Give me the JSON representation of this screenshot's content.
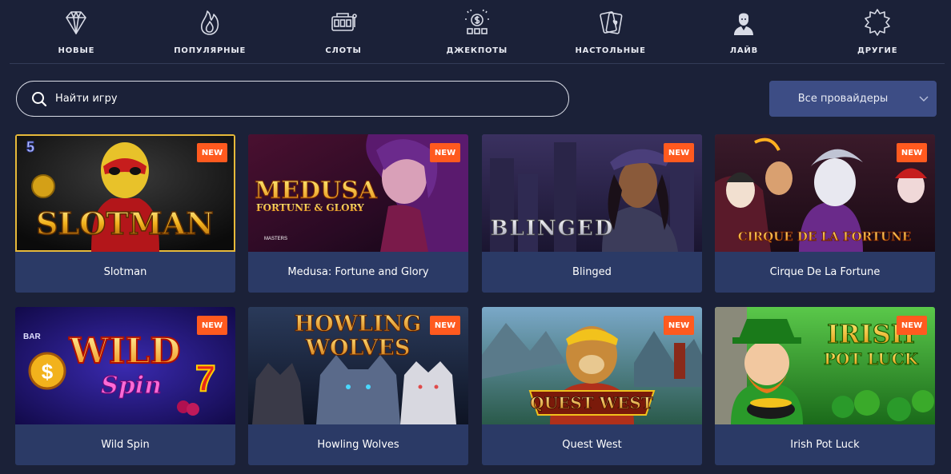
{
  "nav": {
    "items": [
      {
        "label": "НОВЫЕ",
        "icon": "diamond-icon"
      },
      {
        "label": "ПОПУЛЯРНЫЕ",
        "icon": "flame-icon"
      },
      {
        "label": "СЛОТЫ",
        "icon": "slot-machine-icon"
      },
      {
        "label": "ДЖЕКПОТЫ",
        "icon": "jackpot-icon"
      },
      {
        "label": "НАСТОЛЬНЫЕ",
        "icon": "playing-cards-icon"
      },
      {
        "label": "ЛАЙВ",
        "icon": "live-dealer-icon"
      },
      {
        "label": "ДРУГИЕ",
        "icon": "star-burst-icon"
      }
    ]
  },
  "search": {
    "placeholder": "Найти игру",
    "icon": "search-icon"
  },
  "provider": {
    "selected": "Все провайдеры",
    "icon": "chevron-down-icon"
  },
  "games": [
    {
      "title": "Slotman",
      "badge": "NEW",
      "logo": "SLOTMAN",
      "logo_sub": "",
      "corner": "5"
    },
    {
      "title": "Medusa: Fortune and Glory",
      "badge": "NEW",
      "logo": "MEDUSA",
      "logo_sub": "FORTUNE & GLORY",
      "corner": "MASTERS"
    },
    {
      "title": "Blinged",
      "badge": "NEW",
      "logo": "BLINGED",
      "logo_sub": "",
      "corner": ""
    },
    {
      "title": "Cirque De La Fortune",
      "badge": "NEW",
      "logo": "CIRQUE DE LA FORTUNE",
      "logo_sub": "",
      "corner": ""
    },
    {
      "title": "Wild Spin",
      "badge": "NEW",
      "logo": "WILD",
      "logo_sub": "Spin",
      "corner": "BAR"
    },
    {
      "title": "Howling Wolves",
      "badge": "NEW",
      "logo": "HOWLING",
      "logo_sub": "WOLVES",
      "corner": ""
    },
    {
      "title": "Quest West",
      "badge": "NEW",
      "logo": "QUEST WEST",
      "logo_sub": "",
      "corner": ""
    },
    {
      "title": "Irish Pot Luck",
      "badge": "NEW",
      "logo": "IRISH",
      "logo_sub": "POT LUCK",
      "corner": ""
    }
  ],
  "colors": {
    "background": "#1b2138",
    "card": "#2b3a66",
    "badge": "#ff5a1f",
    "provider": "#3d4d85"
  }
}
